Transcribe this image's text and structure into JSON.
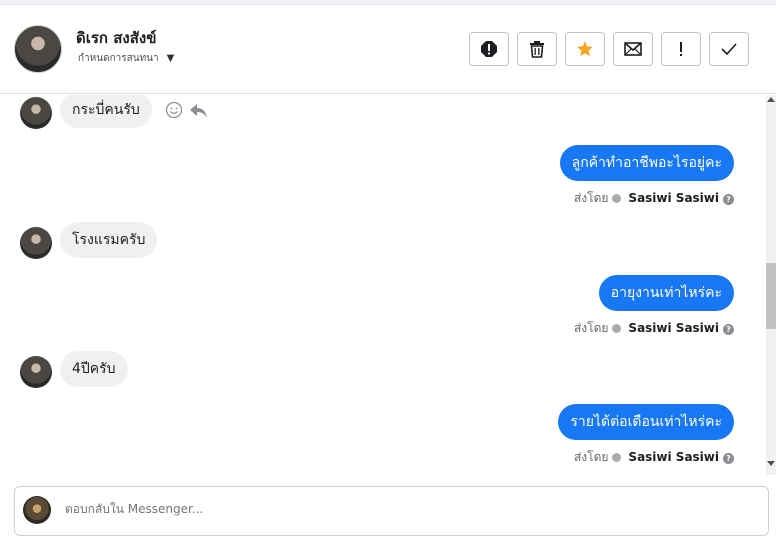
{
  "header": {
    "contact_name": "ดิเรก สงสังข์",
    "assign_label": "กำหนดการสนทนา",
    "actions": [
      {
        "name": "report-button",
        "icon": "exclamation-circle-icon"
      },
      {
        "name": "delete-button",
        "icon": "trash-icon"
      },
      {
        "name": "star-button",
        "icon": "star-icon",
        "color": "#f5a623"
      },
      {
        "name": "email-button",
        "icon": "envelope-icon"
      },
      {
        "name": "important-button",
        "icon": "exclamation-icon"
      },
      {
        "name": "done-button",
        "icon": "checkmark-icon"
      }
    ]
  },
  "messages": [
    {
      "dir": "in",
      "text": "กระบี่คนรับ"
    },
    {
      "dir": "out",
      "text": "ลูกค้าทำอาชีพอะไรอยู่คะ",
      "sent_prefix": "ส่งโดย",
      "sender": "Sasiwi Sasiwi"
    },
    {
      "dir": "in",
      "text": "โรงแรมครับ"
    },
    {
      "dir": "out",
      "text": "อายุงานเท่าไหร่คะ",
      "sent_prefix": "ส่งโดย",
      "sender": "Sasiwi Sasiwi"
    },
    {
      "dir": "in",
      "text": "4ปีครับ"
    },
    {
      "dir": "out",
      "text": "รายได้ต่อเดือนเท่าไหร่คะ",
      "sent_prefix": "ส่งโดย",
      "sender": "Sasiwi Sasiwi"
    }
  ],
  "composer": {
    "placeholder": "ตอบกลับใน Messenger..."
  },
  "colors": {
    "outgoing_bubble": "#1877f2",
    "incoming_bubble": "#f0f0f0",
    "star": "#f5a623"
  }
}
